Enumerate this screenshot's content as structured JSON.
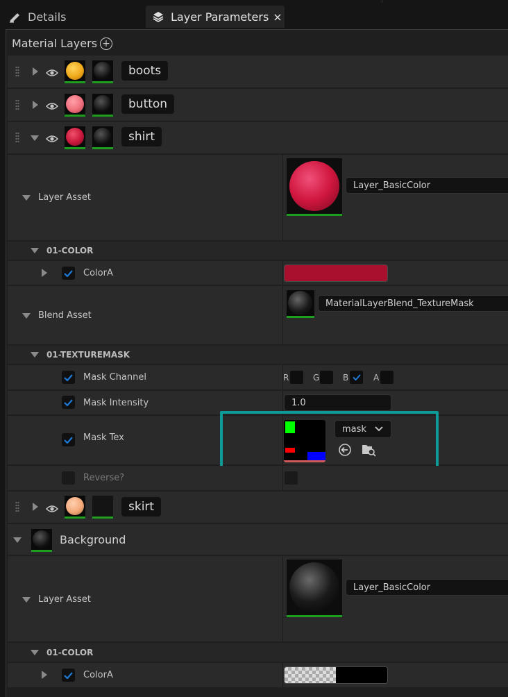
{
  "tabs": [
    {
      "label": "Details",
      "icon": "pencil-icon"
    },
    {
      "label": "Layer Parameters",
      "icon": "layers-icon",
      "close": "×"
    }
  ],
  "header": {
    "title": "Material Layers",
    "add_icon": "add-circle-icon"
  },
  "layers": {
    "boots": {
      "name": "boots",
      "color": "#f0a81a"
    },
    "button": {
      "name": "button",
      "color": "#ef6f7c"
    },
    "shirt": {
      "name": "shirt",
      "color": "#c8163a"
    },
    "skirt": {
      "name": "skirt",
      "color": "#f3a878"
    }
  },
  "shirt": {
    "layer_asset_label": "Layer Asset",
    "layer_asset_value": "Layer_BasicColor",
    "color_section": "01-COLOR",
    "colorA_label": "ColorA",
    "colorA_value": "#a8102e",
    "blend_asset_label": "Blend Asset",
    "blend_asset_value": "MaterialLayerBlend_TextureMask",
    "texmask_section": "01-TEXTUREMASK",
    "mask_channel_label": "Mask Channel",
    "channels": [
      "R",
      "G",
      "B",
      "A"
    ],
    "channel_checked": "B",
    "mask_intensity_label": "Mask Intensity",
    "mask_intensity_value": "1.0",
    "mask_tex_label": "Mask Tex",
    "mask_tex_value": "mask",
    "reverse_label": "Reverse?"
  },
  "background": {
    "name": "Background",
    "layer_asset_label": "Layer Asset",
    "layer_asset_value": "Layer_BasicColor",
    "color_section": "01-COLOR",
    "colorA_label": "ColorA"
  },
  "colors": {
    "highlight": "#0f9a9a",
    "check": "#1e7ad8",
    "green_bar": "#1e9e1e"
  }
}
